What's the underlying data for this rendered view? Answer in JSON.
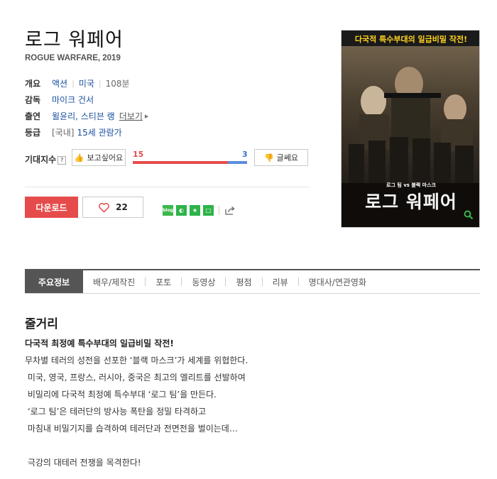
{
  "movie": {
    "title_ko": "로그 워페어",
    "title_en_year": "ROGUE WARFARE, 2019"
  },
  "info": {
    "overview_label": "개요",
    "genre": "액션",
    "country": "미국",
    "runtime": "108분",
    "director_label": "감독",
    "director": "마이크 건서",
    "cast_label": "출연",
    "cast": "윌윤리, 스티븐 랭",
    "more_label": "더보기",
    "rating_label": "등급",
    "rating_region": "[국내]",
    "rating": "15세 관람가"
  },
  "expectation": {
    "label": "기대지수",
    "want_label": "보고싶어요",
    "want_count": "15",
    "meh_label": "글쎄요",
    "meh_count": "3",
    "want_fraction": 0.833
  },
  "actions": {
    "download_label": "다운로드",
    "like_count": "22"
  },
  "poster": {
    "tagline": "다국적 특수부대의 일급비밀 작전!",
    "vs_text": "로그 팀 vs 블랙 마스크",
    "logo_text": "로그 워페어"
  },
  "tabs": [
    {
      "label": "주요정보"
    },
    {
      "label": "배우/제작진"
    },
    {
      "label": "포토"
    },
    {
      "label": "동영상"
    },
    {
      "label": "평점"
    },
    {
      "label": "리뷰"
    },
    {
      "label": "명대사/연관영화"
    }
  ],
  "synopsis": {
    "heading": "줄거리",
    "headline": "다국적 최정예 특수부대의 일급비밀 작전!",
    "lines": [
      "무차별 테러의 성전을 선포한 ‘블랙 마스크’가 세계를 위협한다.",
      " 미국, 영국, 프랑스, 러시아, 중국은 최고의 엘리트를 선발하여",
      " 비밀리에 다국적 최정예 특수부대 ‘로그 팀’을 만든다.",
      " ‘로그 팀’은 테러단의 방사능 폭탄을 정밀 타격하고",
      " 마침내 비밀기지를 습격하여 테러단과 전면전을 벌이는데…",
      "",
      " 극강의 대테러 전쟁을 목격한다!"
    ]
  },
  "colors": {
    "accent_red": "#e64b4b",
    "link_blue": "#1a4fa0",
    "tab_active_bg": "#555555"
  }
}
